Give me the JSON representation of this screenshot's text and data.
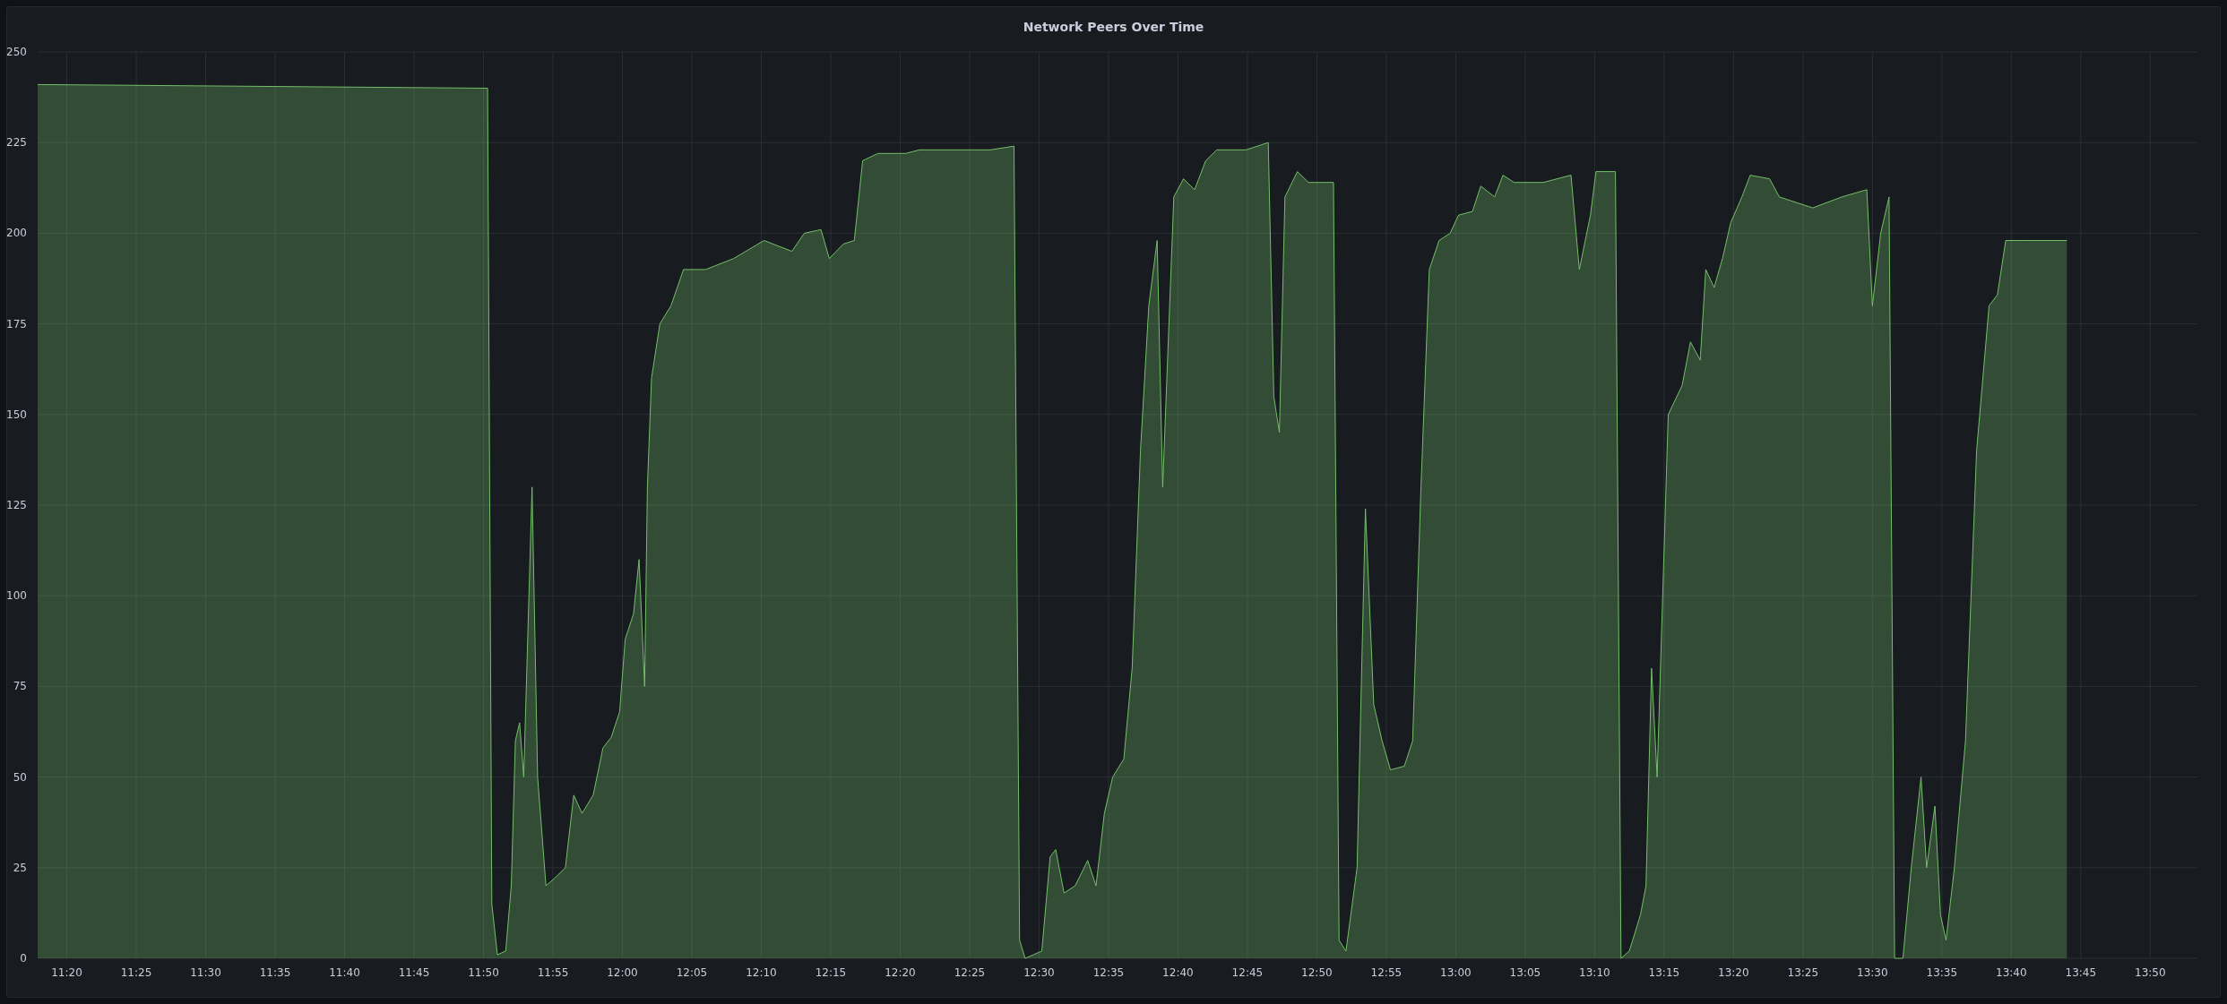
{
  "panel": {
    "chart_data": {
      "type": "area",
      "title": "Network Peers Over Time",
      "grid": true,
      "x": [
        677.9,
        710.3,
        710.6,
        711.0,
        711.6,
        712.0,
        712.3,
        712.6,
        712.9,
        713.5,
        713.9,
        714.5,
        715.1,
        715.9,
        716.5,
        717.1,
        717.9,
        718.6,
        719.2,
        719.8,
        720.2,
        720.8,
        721.2,
        721.6,
        721.8,
        722.1,
        722.7,
        723.5,
        724.4,
        725.2,
        726.0,
        728.0,
        730.2,
        732.2,
        733.1,
        734.3,
        734.9,
        735.9,
        736.7,
        737.3,
        738.4,
        740.4,
        741.4,
        746.5,
        748.2,
        748.6,
        749.0,
        750.2,
        750.8,
        751.2,
        751.8,
        752.6,
        753.5,
        754.1,
        754.7,
        755.3,
        756.1,
        756.7,
        757.3,
        757.9,
        758.5,
        758.9,
        759.7,
        760.4,
        761.2,
        762.0,
        762.8,
        764.9,
        766.5,
        766.9,
        767.3,
        767.7,
        768.6,
        769.4,
        771.2,
        771.6,
        772.1,
        772.9,
        773.5,
        774.1,
        774.7,
        775.3,
        776.3,
        776.9,
        777.5,
        778.1,
        778.8,
        779.6,
        780.2,
        781.2,
        781.8,
        782.8,
        783.4,
        784.2,
        786.3,
        788.3,
        788.9,
        789.7,
        790.1,
        791.5,
        791.9,
        792.5,
        793.3,
        793.7,
        794.1,
        794.5,
        795.3,
        796.3,
        796.9,
        797.6,
        798.0,
        798.6,
        799.2,
        799.8,
        800.6,
        801.2,
        802.6,
        803.3,
        805.7,
        807.8,
        809.6,
        810.0,
        810.6,
        811.2,
        811.6,
        812.2,
        812.8,
        813.5,
        813.9,
        814.5,
        814.9,
        815.3,
        815.9,
        816.7,
        817.5,
        818.4,
        819.0,
        819.6,
        821.0,
        824.0
      ],
      "series": [
        {
          "color": "#73bf69",
          "values": [
            241,
            240,
            15,
            1,
            2,
            20,
            60,
            65,
            50,
            130,
            50,
            20,
            22,
            25,
            45,
            40,
            45,
            58,
            61,
            68,
            88,
            95,
            110,
            75,
            130,
            160,
            175,
            180,
            190,
            190,
            190,
            193,
            198,
            195,
            200,
            201,
            193,
            197,
            198,
            220,
            222,
            222,
            223,
            223,
            224,
            5,
            0,
            2,
            28,
            30,
            18,
            20,
            27,
            20,
            40,
            50,
            55,
            80,
            140,
            180,
            198,
            130,
            210,
            215,
            212,
            220,
            223,
            223,
            225,
            155,
            145,
            210,
            217,
            214,
            214,
            5,
            2,
            25,
            124,
            70,
            60,
            52,
            53,
            60,
            130,
            190,
            198,
            200,
            205,
            206,
            213,
            210,
            216,
            214,
            214,
            216,
            190,
            205,
            217,
            217,
            0,
            2,
            12,
            20,
            80,
            50,
            150,
            158,
            170,
            165,
            190,
            185,
            193,
            203,
            210,
            216,
            215,
            210,
            207,
            210,
            212,
            180,
            200,
            210,
            0,
            0,
            25,
            50,
            25,
            42,
            12,
            5,
            25,
            60,
            140,
            180,
            183,
            198,
            198,
            198
          ]
        }
      ],
      "xlim": [
        677.9,
        833.4
      ],
      "ylim": [
        0,
        250
      ],
      "xticks": [
        {
          "value": 680,
          "label": "11:20"
        },
        {
          "value": 685,
          "label": "11:25"
        },
        {
          "value": 690,
          "label": "11:30"
        },
        {
          "value": 695,
          "label": "11:35"
        },
        {
          "value": 700,
          "label": "11:40"
        },
        {
          "value": 705,
          "label": "11:45"
        },
        {
          "value": 710,
          "label": "11:50"
        },
        {
          "value": 715,
          "label": "11:55"
        },
        {
          "value": 720,
          "label": "12:00"
        },
        {
          "value": 725,
          "label": "12:05"
        },
        {
          "value": 730,
          "label": "12:10"
        },
        {
          "value": 735,
          "label": "12:15"
        },
        {
          "value": 740,
          "label": "12:20"
        },
        {
          "value": 745,
          "label": "12:25"
        },
        {
          "value": 750,
          "label": "12:30"
        },
        {
          "value": 755,
          "label": "12:35"
        },
        {
          "value": 760,
          "label": "12:40"
        },
        {
          "value": 765,
          "label": "12:45"
        },
        {
          "value": 770,
          "label": "12:50"
        },
        {
          "value": 775,
          "label": "12:55"
        },
        {
          "value": 780,
          "label": "13:00"
        },
        {
          "value": 785,
          "label": "13:05"
        },
        {
          "value": 790,
          "label": "13:10"
        },
        {
          "value": 795,
          "label": "13:15"
        },
        {
          "value": 800,
          "label": "13:20"
        },
        {
          "value": 805,
          "label": "13:25"
        },
        {
          "value": 810,
          "label": "13:30"
        },
        {
          "value": 815,
          "label": "13:35"
        },
        {
          "value": 820,
          "label": "13:40"
        },
        {
          "value": 825,
          "label": "13:45"
        },
        {
          "value": 830,
          "label": "13:50"
        }
      ],
      "yticks": [
        0,
        25,
        50,
        75,
        100,
        125,
        150,
        175,
        200,
        225,
        250
      ]
    }
  }
}
